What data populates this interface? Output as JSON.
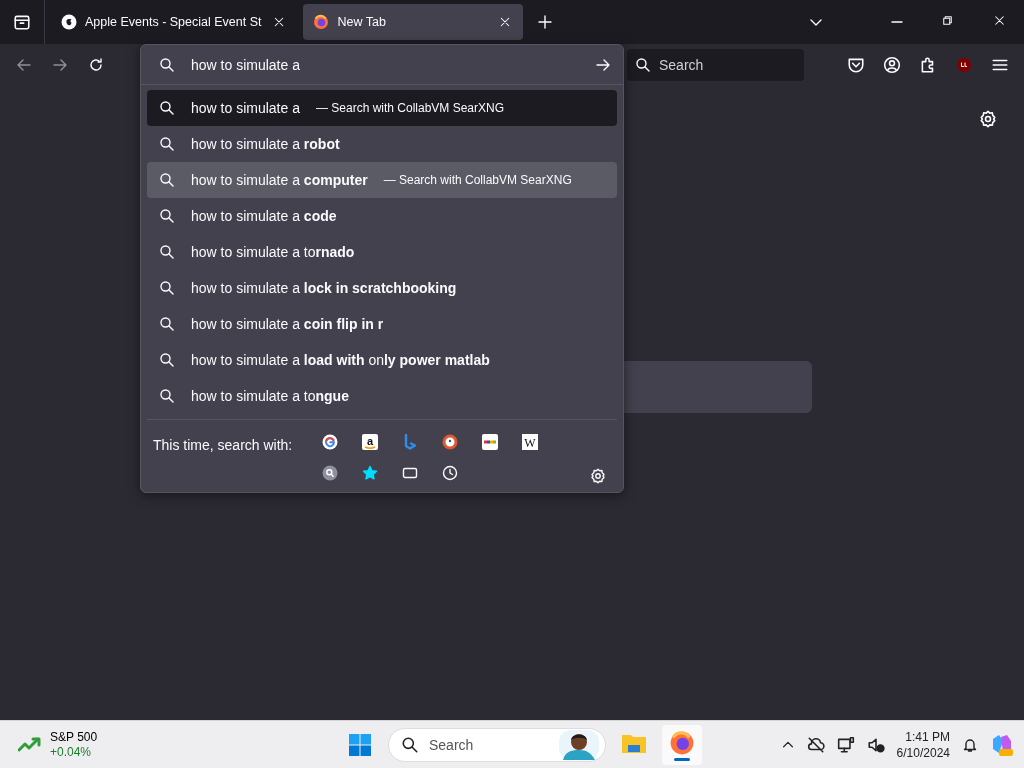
{
  "tabs": [
    {
      "title": "Apple Events - Special Event St",
      "kind": "apple",
      "selected": false
    },
    {
      "title": "New Tab",
      "kind": "firefox",
      "selected": true
    }
  ],
  "address_bar": {
    "value": "how to simulate a "
  },
  "web_search": {
    "placeholder": "Search"
  },
  "suggestions": [
    {
      "text": "how to simulate a ",
      "action": "— Search with CollabVM SearXNG",
      "kind": "heuristic",
      "selected": false
    },
    {
      "text": "how to simulate a **robot**",
      "kind": "suggestion",
      "selected": false
    },
    {
      "text": "how to simulate a **computer**",
      "action": "— Search with CollabVM SearXNG",
      "kind": "suggestion",
      "selected": true
    },
    {
      "text": "how to simulate a **code**",
      "kind": "suggestion",
      "selected": false
    },
    {
      "text": "how to simulate a to**rnado**",
      "kind": "suggestion",
      "selected": false
    },
    {
      "text": "how to simulate a **lock in scratchbooking**",
      "kind": "suggestion",
      "selected": false
    },
    {
      "text": "how to simulate a **coin flip in r**",
      "kind": "suggestion",
      "selected": false
    },
    {
      "text": "how to simulate a **load with** on**ly power matlab**",
      "kind": "suggestion",
      "selected": false
    },
    {
      "text": "how to simulate a to**ngue**",
      "kind": "suggestion",
      "selected": false
    }
  ],
  "search_with": {
    "label": "This time, search with:",
    "engines": [
      {
        "kind": "google"
      },
      {
        "kind": "amazon",
        "glyph": "a"
      },
      {
        "kind": "bing"
      },
      {
        "kind": "duckduckgo"
      },
      {
        "kind": "ebay"
      },
      {
        "kind": "wikipedia",
        "glyph": "W"
      }
    ],
    "modes": [
      {
        "kind": "search"
      },
      {
        "kind": "bookmarks"
      },
      {
        "kind": "tabs"
      },
      {
        "kind": "history"
      }
    ]
  },
  "taskbar": {
    "widget": {
      "title": "S&P 500",
      "change": "+0.04%"
    },
    "search": {
      "placeholder": "Search"
    },
    "apps": [
      {
        "kind": "files",
        "selected": false
      },
      {
        "kind": "firefox",
        "selected": true
      }
    ],
    "time": "1:41 PM",
    "date": "6/10/2024"
  }
}
